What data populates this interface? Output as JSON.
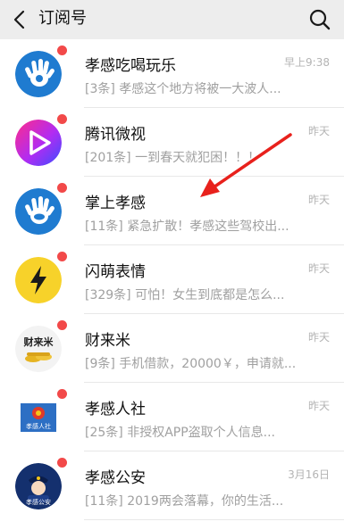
{
  "header": {
    "title": "订阅号"
  },
  "accounts": [
    {
      "name": "孝感吃喝玩乐",
      "snippet": "[3条] 孝感这个地方将被一大波人...",
      "time": "早上9:38",
      "avatar": "hand-logo-icon",
      "unread": true
    },
    {
      "name": "腾讯微视",
      "snippet": "[201条] 一到春天就犯困！！！",
      "time": "昨天",
      "avatar": "weishi-play-icon",
      "unread": true
    },
    {
      "name": "掌上孝感",
      "snippet": "[11条] 紧急扩散！孝感这些驾校出...",
      "time": "昨天",
      "avatar": "hand-logo-icon",
      "unread": true
    },
    {
      "name": "闪萌表情",
      "snippet": "[329条] 可怕！女生到底都是怎么...",
      "time": "昨天",
      "avatar": "lightning-icon",
      "unread": true
    },
    {
      "name": "财来米",
      "snippet": "[9条] 手机借款，20000￥，申请就...",
      "time": "昨天",
      "avatar": "gold-coins-icon",
      "avatar_text": "财来米",
      "unread": true
    },
    {
      "name": "孝感人社",
      "snippet": "[25条] 非授权APP盗取个人信息...",
      "time": "昨天",
      "avatar": "emblem-icon",
      "avatar_text": "孝感人社",
      "unread": true
    },
    {
      "name": "孝感公安",
      "snippet": "[11条] 2019两会落幕，你的生活...",
      "time": "3月16日",
      "avatar": "police-icon",
      "avatar_text": "孝感公安",
      "unread": true
    }
  ],
  "colors": {
    "header_bg": "#ededed",
    "unread_dot": "#f24949",
    "annotation_arrow": "#e8211c"
  }
}
